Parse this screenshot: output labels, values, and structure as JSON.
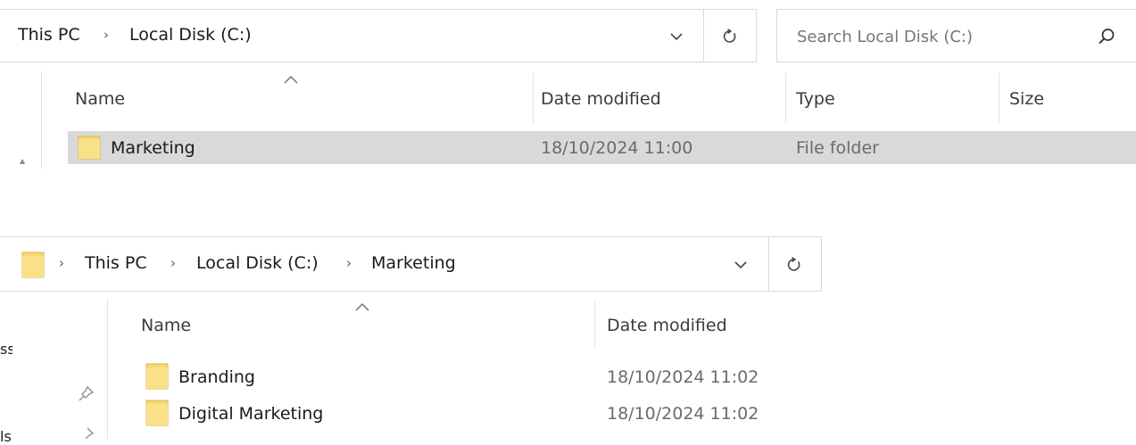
{
  "panel1": {
    "breadcrumb": [
      "This PC",
      "Local Disk (C:)"
    ],
    "search_placeholder": "Search Local Disk (C:)",
    "columns": {
      "name": "Name",
      "date": "Date modified",
      "type": "Type",
      "size": "Size"
    },
    "rows": [
      {
        "name": "Marketing",
        "date": "18/10/2024 11:00",
        "type": "File folder"
      }
    ]
  },
  "panel2": {
    "breadcrumb": [
      "This PC",
      "Local Disk (C:)",
      "Marketing"
    ],
    "columns": {
      "name": "Name",
      "date": "Date modified"
    },
    "rows": [
      {
        "name": "Branding",
        "date": "18/10/2024 11:02"
      },
      {
        "name": "Digital Marketing",
        "date": "18/10/2024 11:02"
      }
    ],
    "sidebar_fragments": [
      "ss",
      "ls"
    ]
  },
  "colors": {
    "selection": "#d9d9d9",
    "folder": "#f8d775",
    "folder_edge": "#e0b640"
  }
}
